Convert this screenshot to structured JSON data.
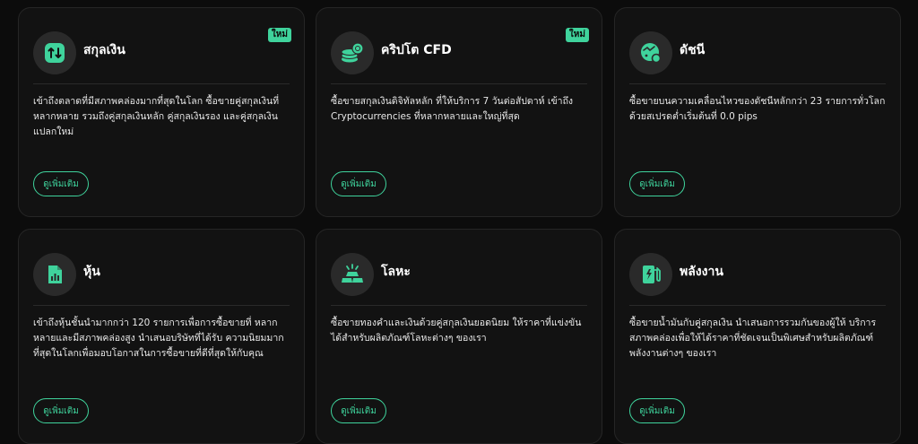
{
  "colors": {
    "accent": "#3fd39c",
    "card_bg": "#121212",
    "page_bg": "#0c0c0c"
  },
  "cards": [
    {
      "title": "สกุลเงิน",
      "icon": "currency-exchange-icon",
      "badge": "ใหม่",
      "description": "เข้าถึงตลาดที่มีสภาพคล่องมากที่สุดในโลก ซื้อขายคู่สกุลเงินที่หลากหลาย รวมถึงคู่สกุลเงินหลัก คู่สกุลเงินรอง และคู่สกุลเงินแปลกใหม่",
      "button": "ดูเพิ่มเติม"
    },
    {
      "title": "คริปโต CFD",
      "icon": "coins-icon",
      "badge": "ใหม่",
      "description": "ซื้อขายสกุลเงินดิจิทัลหลัก ที่ให้บริการ 7 วันต่อสัปดาห์ เข้าถึง Cryptocurrencies ที่หลากหลายและใหญ่ที่สุด",
      "button": "ดูเพิ่มเติม"
    },
    {
      "title": "ดัชนี",
      "icon": "index-icon",
      "badge": "",
      "description": "ซื้อขายบนความเคลื่อนไหวของดัชนีหลักกว่า 23 รายการทั่วโลกด้วยสเปรดต่ำเริ่มต้นที่ 0.0 pips",
      "button": "ดูเพิ่มเติม"
    },
    {
      "title": "หุ้น",
      "icon": "stock-document-icon",
      "badge": "",
      "description": "เข้าถึงหุ้นชั้นนำมากกว่า 120 รายการเพื่อการซื้อขายที่ หลากหลายและมีสภาพคล่องสูง นำเสนอบริษัทที่ได้รับ ความนิยมมากที่สุดในโลกเพื่อมอบโอกาสในการซื้อขายที่ดีที่สุดให้กับคุณ",
      "button": "ดูเพิ่มเติม"
    },
    {
      "title": "โลหะ",
      "icon": "gold-bars-icon",
      "badge": "",
      "description": "ซื้อขายทองคำและเงินด้วยคู่สกุลเงินยอดนิยม ให้ราคาที่แข่งขันได้สำหรับผลิตภัณฑ์โลหะต่างๆ ของเรา",
      "button": "ดูเพิ่มเติม"
    },
    {
      "title": "พลังงาน",
      "icon": "fuel-pump-icon",
      "badge": "",
      "description": "ซื้อขายน้ำมันกับคู่สกุลเงิน นำเสนอการรวมกันของผู้ให้ บริการสภาพคล่องเพื่อให้ได้ราคาที่ชัดเจนเป็นพิเศษสำหรับผลิตภัณฑ์พลังงานต่างๆ ของเรา",
      "button": "ดูเพิ่มเติม"
    }
  ]
}
